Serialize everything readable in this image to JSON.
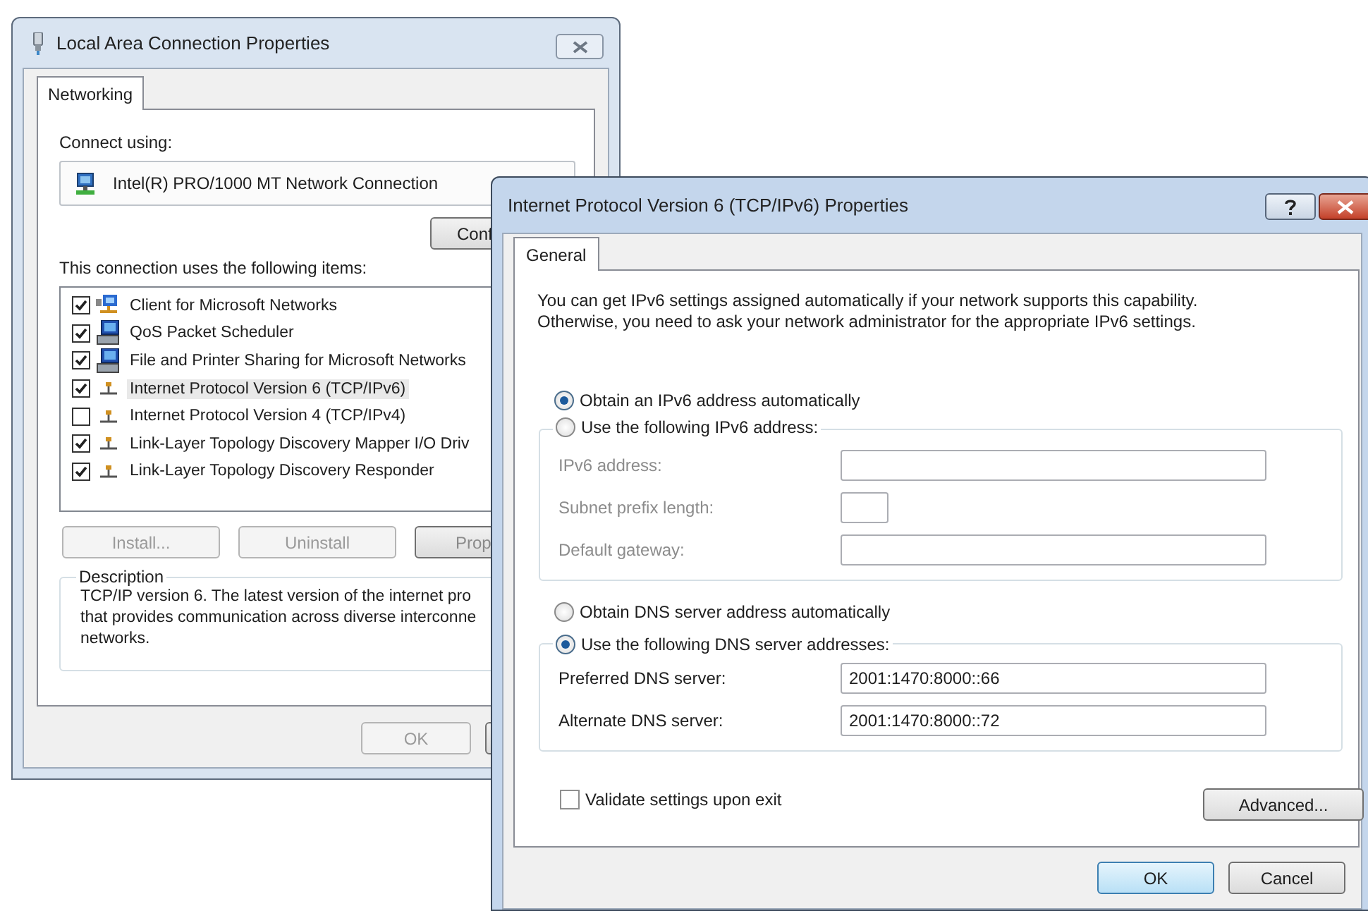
{
  "connection_dialog": {
    "title": "Local Area Connection Properties",
    "tabs": [
      {
        "label": "Networking",
        "selected": true
      }
    ],
    "connect_using_label": "Connect using:",
    "adapter": "Intel(R) PRO/1000 MT Network Connection",
    "configure_button": "Conf",
    "items_label": "This connection uses the following items:",
    "items": [
      {
        "kind": "client",
        "label": "Client for Microsoft Networks",
        "checked": true,
        "selected": false
      },
      {
        "kind": "service",
        "label": "QoS Packet Scheduler",
        "checked": true,
        "selected": false
      },
      {
        "kind": "service",
        "label": "File and Printer Sharing for Microsoft Networks",
        "checked": true,
        "selected": false
      },
      {
        "kind": "protocol",
        "label": "Internet Protocol Version 6 (TCP/IPv6)",
        "checked": true,
        "selected": true
      },
      {
        "kind": "protocol",
        "label": "Internet Protocol Version 4 (TCP/IPv4)",
        "checked": false,
        "selected": false
      },
      {
        "kind": "protocol",
        "label": "Link-Layer Topology Discovery Mapper I/O Driv",
        "checked": true,
        "selected": false
      },
      {
        "kind": "protocol",
        "label": "Link-Layer Topology Discovery Responder",
        "checked": true,
        "selected": false
      }
    ],
    "item_buttons": [
      {
        "label": "Install...",
        "disabled": true
      },
      {
        "label": "Uninstall",
        "disabled": true
      },
      {
        "label": "Prop",
        "disabled": false
      }
    ],
    "description": {
      "legend": "Description",
      "lines": [
        "TCP/IP version 6. The latest version of the internet pro",
        "that provides communication across diverse interconne",
        "networks."
      ]
    },
    "footer_buttons": [
      {
        "label": "OK",
        "disabled": true
      }
    ]
  },
  "ipv6_dialog": {
    "title": "Internet Protocol Version 6 (TCP/IPv6) Properties",
    "tabs": [
      {
        "label": "General",
        "selected": true
      }
    ],
    "intro": "You can get IPv6 settings assigned automatically if your network supports this capability.\nOtherwise, you need to ask your network administrator for the appropriate IPv6 settings.",
    "address_options": [
      {
        "label": "Obtain an IPv6 address automatically",
        "selected": true
      },
      {
        "label": "Use the following IPv6 address:",
        "selected": false
      }
    ],
    "address_fields": [
      {
        "label": "IPv6 address:",
        "kind": "wide",
        "disabled": true
      },
      {
        "label": "Subnet prefix length:",
        "kind": "short",
        "disabled": true
      },
      {
        "label": "Default gateway:",
        "kind": "wide",
        "disabled": true
      }
    ],
    "dns_options": [
      {
        "label": "Obtain DNS server address automatically",
        "selected": false
      },
      {
        "label": "Use the following DNS server addresses:",
        "selected": true
      }
    ],
    "dns_fields": [
      {
        "label": "Preferred DNS server:",
        "kind": "wide",
        "disabled": false,
        "value": "2001:1470:8000::66"
      },
      {
        "label": "Alternate DNS server:",
        "kind": "wide",
        "disabled": false,
        "value": "2001:1470:8000::72"
      }
    ],
    "validate": {
      "label": "Validate settings upon exit",
      "checked": false
    },
    "advanced_button": "Advanced...",
    "buttons": [
      {
        "label": "OK",
        "default": true
      },
      {
        "label": "Cancel",
        "default": false
      }
    ]
  }
}
